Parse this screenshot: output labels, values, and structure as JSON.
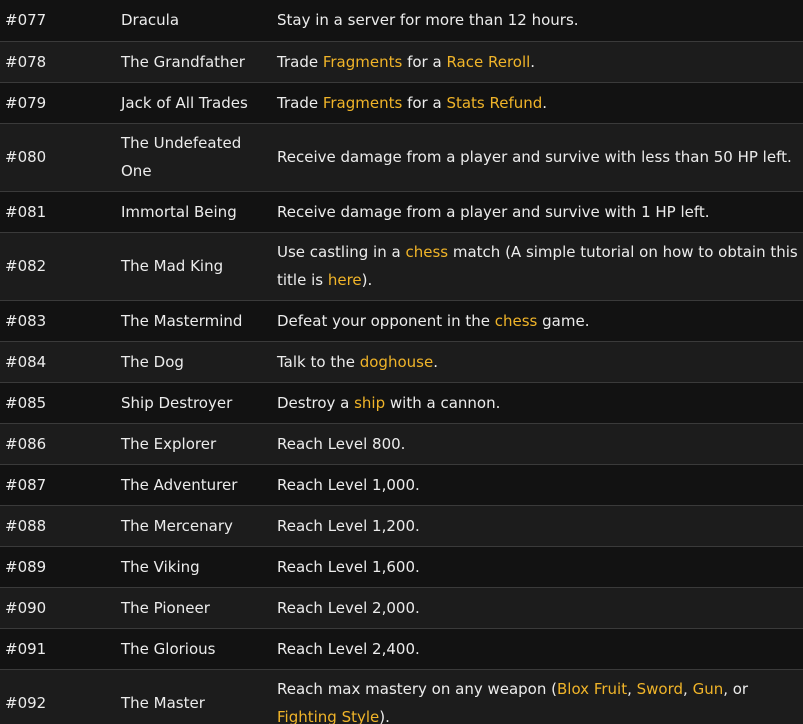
{
  "link_color": "#f0b429",
  "rows": [
    {
      "id": "#077",
      "title": "Dracula",
      "desc": [
        {
          "t": "Stay in a server for more than 12 hours."
        }
      ]
    },
    {
      "id": "#078",
      "title": "The Grandfather",
      "desc": [
        {
          "t": "Trade "
        },
        {
          "t": "Fragments",
          "link": true
        },
        {
          "t": " for a "
        },
        {
          "t": "Race Reroll",
          "link": true
        },
        {
          "t": "."
        }
      ]
    },
    {
      "id": "#079",
      "title": "Jack of All Trades",
      "desc": [
        {
          "t": "Trade "
        },
        {
          "t": "Fragments",
          "link": true
        },
        {
          "t": " for a "
        },
        {
          "t": "Stats Refund",
          "link": true
        },
        {
          "t": "."
        }
      ]
    },
    {
      "id": "#080",
      "title": "The Undefeated One",
      "desc": [
        {
          "t": "Receive damage from a player and survive with less than 50 HP left."
        }
      ]
    },
    {
      "id": "#081",
      "title": "Immortal Being",
      "desc": [
        {
          "t": "Receive damage from a player and survive with 1 HP left."
        }
      ]
    },
    {
      "id": "#082",
      "title": "The Mad King",
      "desc": [
        {
          "t": "Use castling in a "
        },
        {
          "t": "chess",
          "link": true
        },
        {
          "t": " match (A simple tutorial on how to obtain this title is "
        },
        {
          "t": "here",
          "link": true
        },
        {
          "t": ")."
        }
      ]
    },
    {
      "id": "#083",
      "title": "The Mastermind",
      "desc": [
        {
          "t": "Defeat your opponent in the "
        },
        {
          "t": "chess",
          "link": true
        },
        {
          "t": " game."
        }
      ]
    },
    {
      "id": "#084",
      "title": "The Dog",
      "desc": [
        {
          "t": "Talk to the "
        },
        {
          "t": "doghouse",
          "link": true
        },
        {
          "t": "."
        }
      ]
    },
    {
      "id": "#085",
      "title": "Ship Destroyer",
      "desc": [
        {
          "t": "Destroy a "
        },
        {
          "t": "ship",
          "link": true
        },
        {
          "t": " with a cannon."
        }
      ]
    },
    {
      "id": "#086",
      "title": "The Explorer",
      "desc": [
        {
          "t": "Reach Level 800."
        }
      ]
    },
    {
      "id": "#087",
      "title": "The Adventurer",
      "desc": [
        {
          "t": "Reach Level 1,000."
        }
      ]
    },
    {
      "id": "#088",
      "title": "The Mercenary",
      "desc": [
        {
          "t": "Reach Level 1,200."
        }
      ]
    },
    {
      "id": "#089",
      "title": "The Viking",
      "desc": [
        {
          "t": "Reach Level 1,600."
        }
      ]
    },
    {
      "id": "#090",
      "title": "The Pioneer",
      "desc": [
        {
          "t": "Reach Level 2,000."
        }
      ]
    },
    {
      "id": "#091",
      "title": "The Glorious",
      "desc": [
        {
          "t": "Reach Level 2,400."
        }
      ]
    },
    {
      "id": "#092",
      "title": "The Master",
      "desc": [
        {
          "t": "Reach max mastery on any weapon ("
        },
        {
          "t": "Blox Fruit",
          "link": true
        },
        {
          "t": ", "
        },
        {
          "t": "Sword",
          "link": true
        },
        {
          "t": ", "
        },
        {
          "t": "Gun",
          "link": true
        },
        {
          "t": ", or "
        },
        {
          "t": "Fighting Style",
          "link": true
        },
        {
          "t": ")."
        }
      ]
    }
  ]
}
